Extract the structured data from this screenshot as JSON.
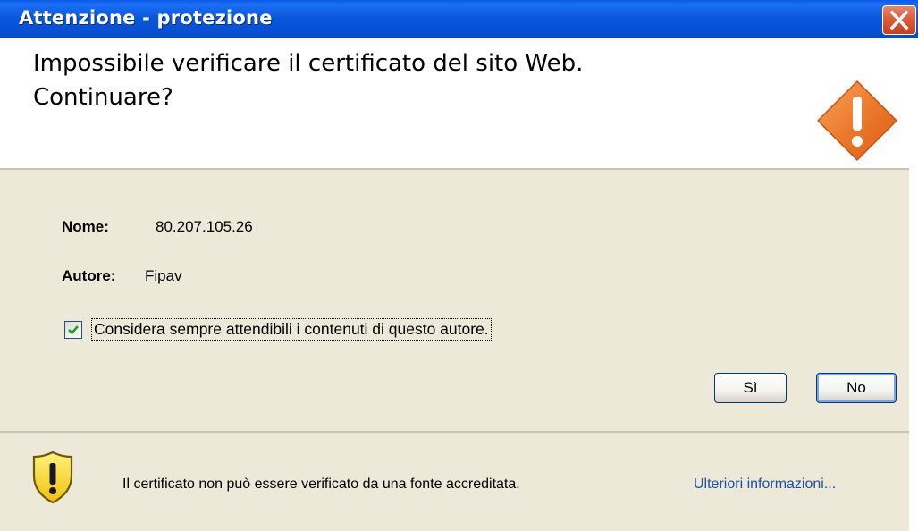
{
  "window": {
    "title": "Attenzione - protezione"
  },
  "header": {
    "heading_line1": "Impossibile verificare il certificato del sito Web.",
    "heading_line2": "Continuare?",
    "icon": "warning-diamond-icon"
  },
  "details": {
    "name_label": "Nome:",
    "name_value": "80.207.105.26",
    "author_label": "Autore:",
    "author_value": "Fipav"
  },
  "trust_option": {
    "label": "Considera sempre attendibili i contenuti di questo autore.",
    "checked": true
  },
  "buttons": {
    "yes": "Sì",
    "no": "No"
  },
  "footer": {
    "icon": "shield-warning-icon",
    "message": "Il certificato non può essere verificato da una fonte accreditata.",
    "more_info": "Ulteriori informazioni..."
  },
  "colors": {
    "titlebar": "#0550d4",
    "dialog_bg": "#ece9d8",
    "close_button": "#d85a36",
    "warning_orange": "#e8732a",
    "link": "#1e4ea8"
  }
}
